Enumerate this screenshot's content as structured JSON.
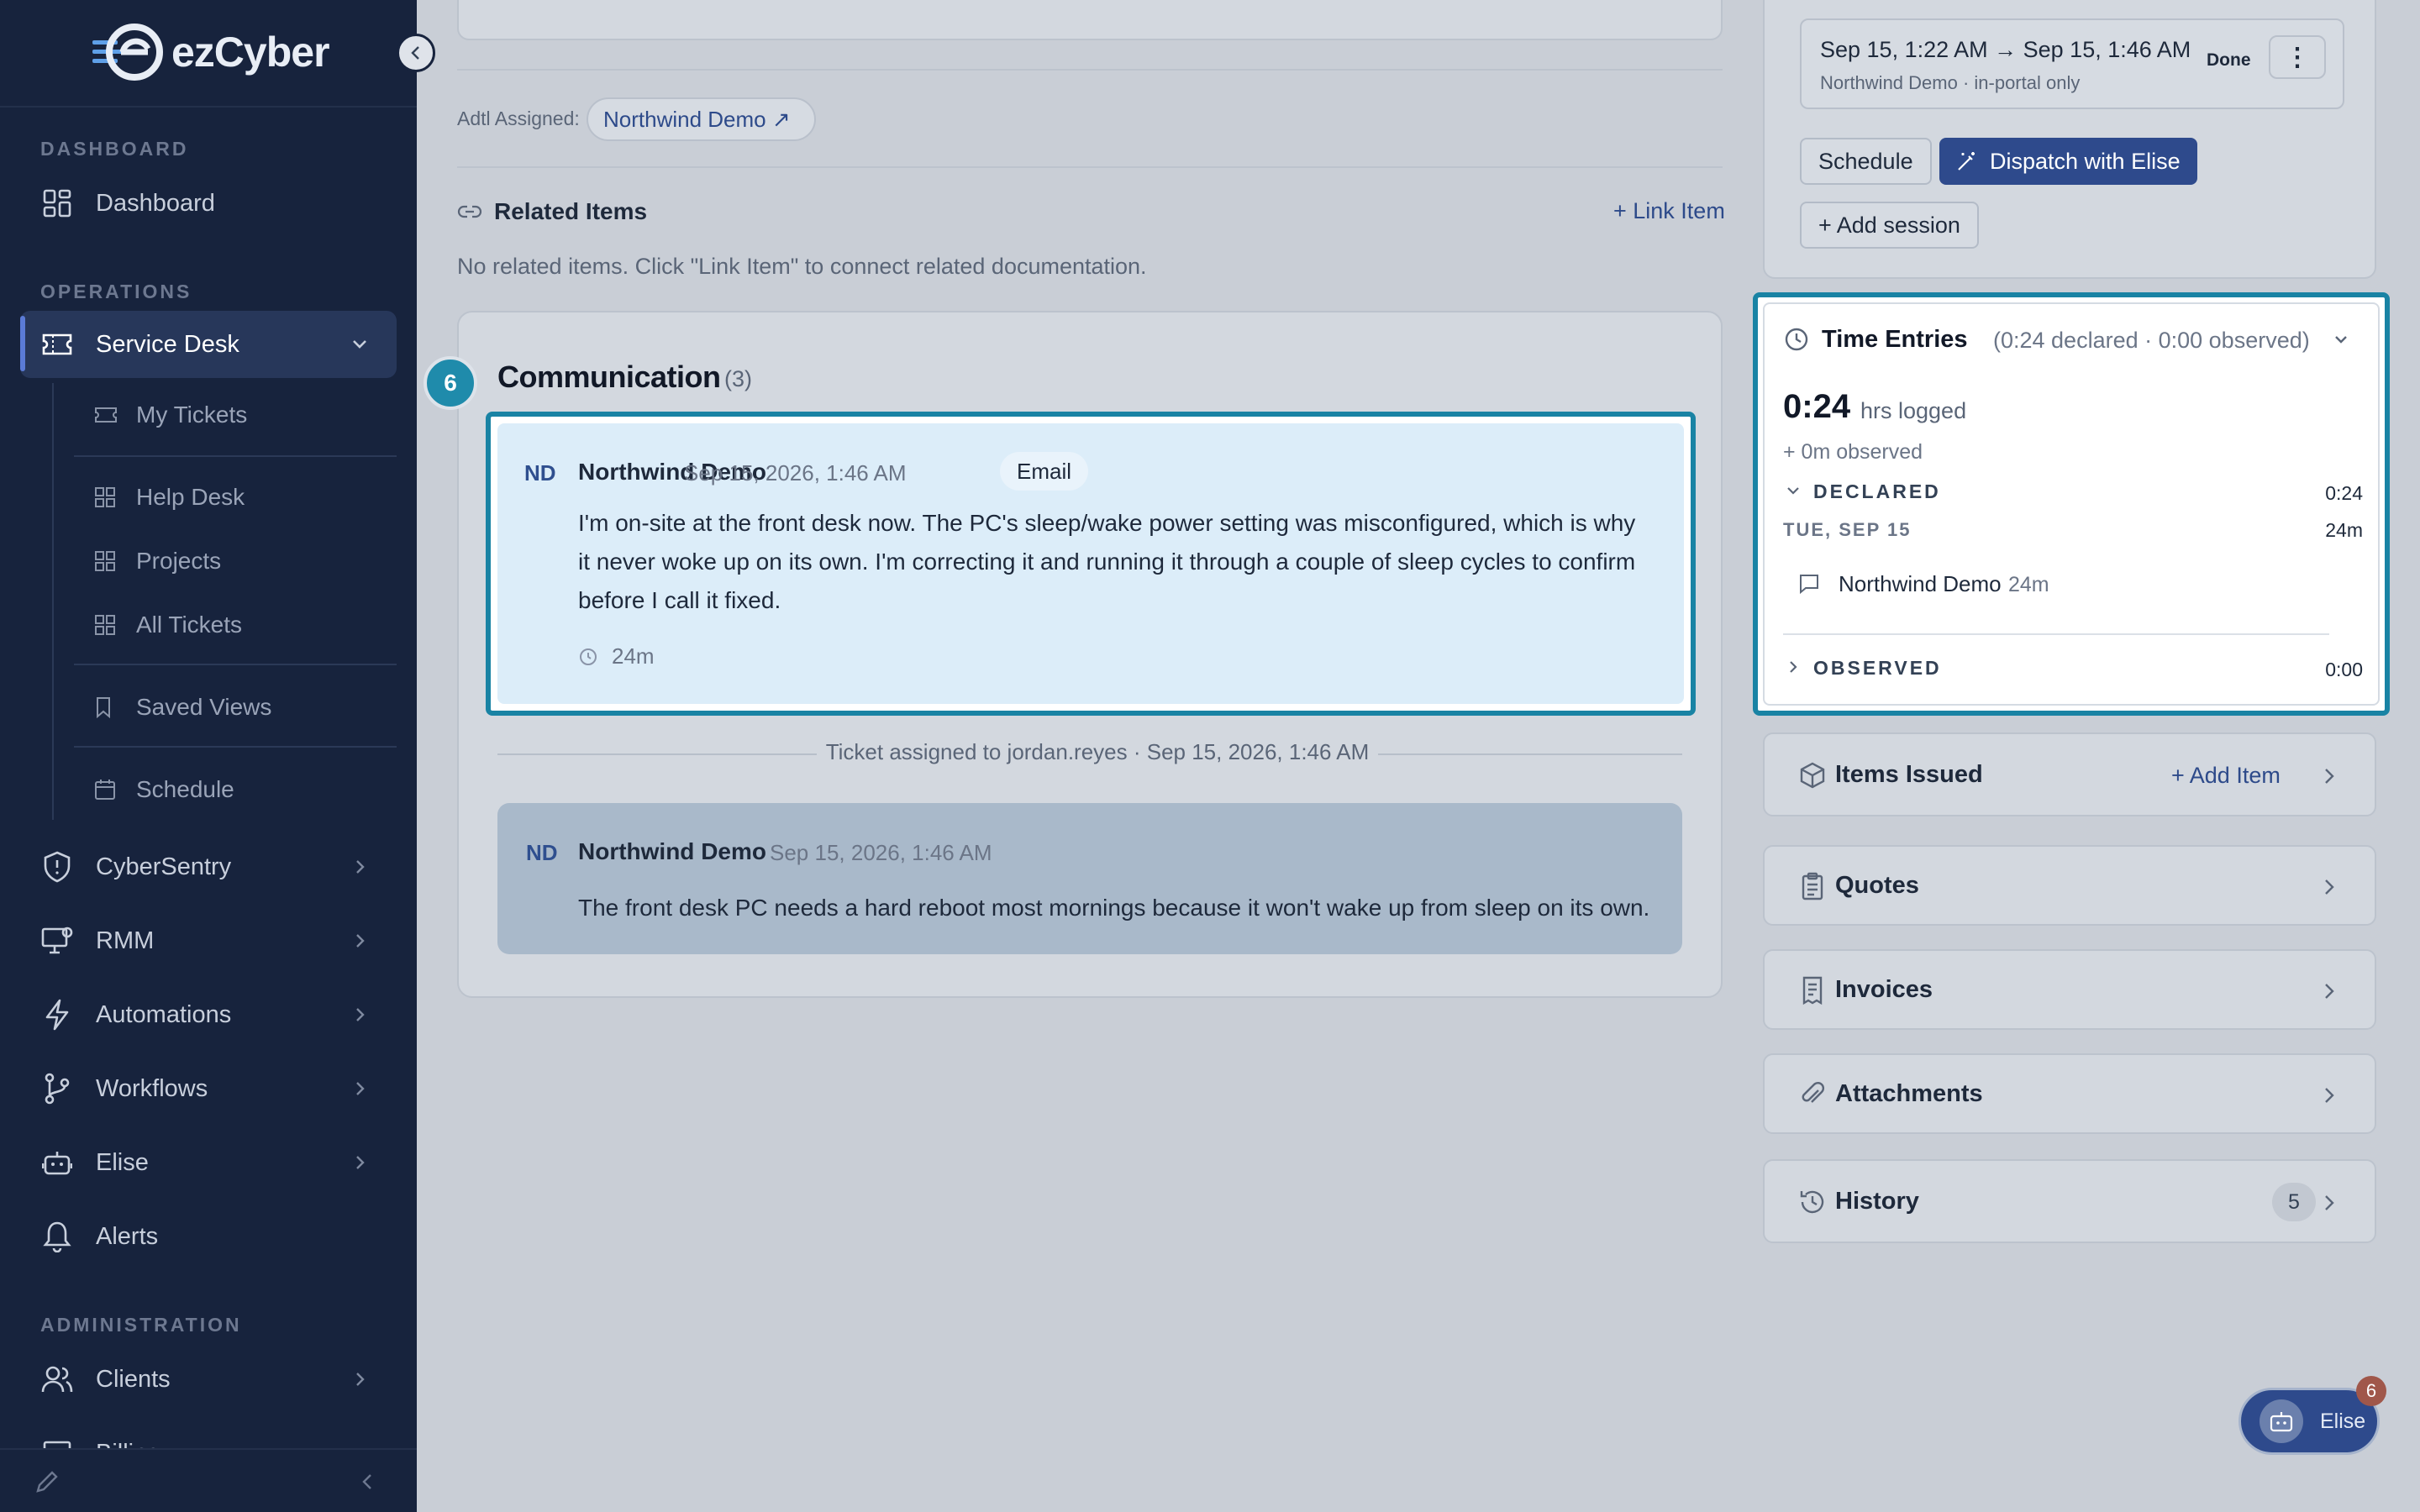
{
  "brand": {
    "name": "ezCyber",
    "accent": "#2e4a8c",
    "highlight": "#1983a4"
  },
  "sidebar": {
    "sections": {
      "dashboard": "DASHBOARD",
      "operations": "OPERATIONS",
      "administration": "ADMINISTRATION"
    },
    "items": {
      "dashboard": "Dashboard",
      "service_desk": "Service Desk",
      "cybersentry": "CyberSentry",
      "rmm": "RMM",
      "automations": "Automations",
      "workflows": "Workflows",
      "elise": "Elise",
      "alerts": "Alerts",
      "clients": "Clients",
      "billing": "Billing"
    },
    "sub_items": {
      "my_tickets": "My Tickets",
      "help_desk": "Help Desk",
      "projects": "Projects",
      "all_tickets": "All Tickets",
      "saved_views": "Saved Views",
      "schedule": "Schedule"
    }
  },
  "main": {
    "adtl_label": "Adtl Assigned:",
    "adtl_value": "Northwind Demo ↗",
    "related": {
      "title": "Related Items",
      "link_label": "+ Link Item",
      "empty": "No related items. Click \"Link Item\" to connect related documentation."
    },
    "communication": {
      "step": "6",
      "title": "Communication",
      "count": "(3)",
      "messages": [
        {
          "initials": "ND",
          "author": "Northwind Demo",
          "date": "Sep 15, 2026, 1:46 AM",
          "channel": "Email",
          "lines": [
            "I'm on-site at the front desk now. The PC's sleep/wake power setting was misconfigured, which is why",
            "it never woke up on its own. I'm correcting it and running it through a couple of sleep cycles to confirm",
            "before I call it fixed."
          ],
          "duration": "24m"
        },
        {
          "initials": "ND",
          "author": "Northwind Demo",
          "date": "Sep 15, 2026, 1:46 AM",
          "body": "The front desk PC needs a hard reboot most mornings because it won't wake up from sleep on its own."
        }
      ],
      "assignment": "Ticket assigned to jordan.reyes · Sep 15, 2026, 1:46 AM"
    }
  },
  "right": {
    "session": {
      "time": "Sep 15, 1:22 AM → Sep 15, 1:46 AM",
      "sub": "Northwind Demo · in-portal only",
      "status": "Done",
      "kebab": "⋮"
    },
    "buttons": {
      "schedule": "Schedule",
      "dispatch": "Dispatch with Elise",
      "add_session": "+ Add session"
    },
    "time_entries": {
      "title": "Time Entries",
      "summary": "(0:24 declared · 0:00 observed)",
      "total": "0:24",
      "total_unit": "hrs logged",
      "observed_sub": "+ 0m observed",
      "declared_label": "DECLARED",
      "declared_value": "0:24",
      "day_label": "TUE, SEP 15",
      "day_value": "24m",
      "entry_name": "Northwind Demo",
      "entry_value": "24m",
      "observed_label": "OBSERVED",
      "observed_value": "0:00"
    },
    "items_issued": {
      "title": "Items Issued",
      "action": "+ Add Item"
    },
    "quotes": {
      "title": "Quotes"
    },
    "invoices": {
      "title": "Invoices"
    },
    "attachments": {
      "title": "Attachments"
    },
    "history": {
      "title": "History",
      "count": "5"
    }
  },
  "fab": {
    "label": "Elise",
    "badge": "6"
  }
}
